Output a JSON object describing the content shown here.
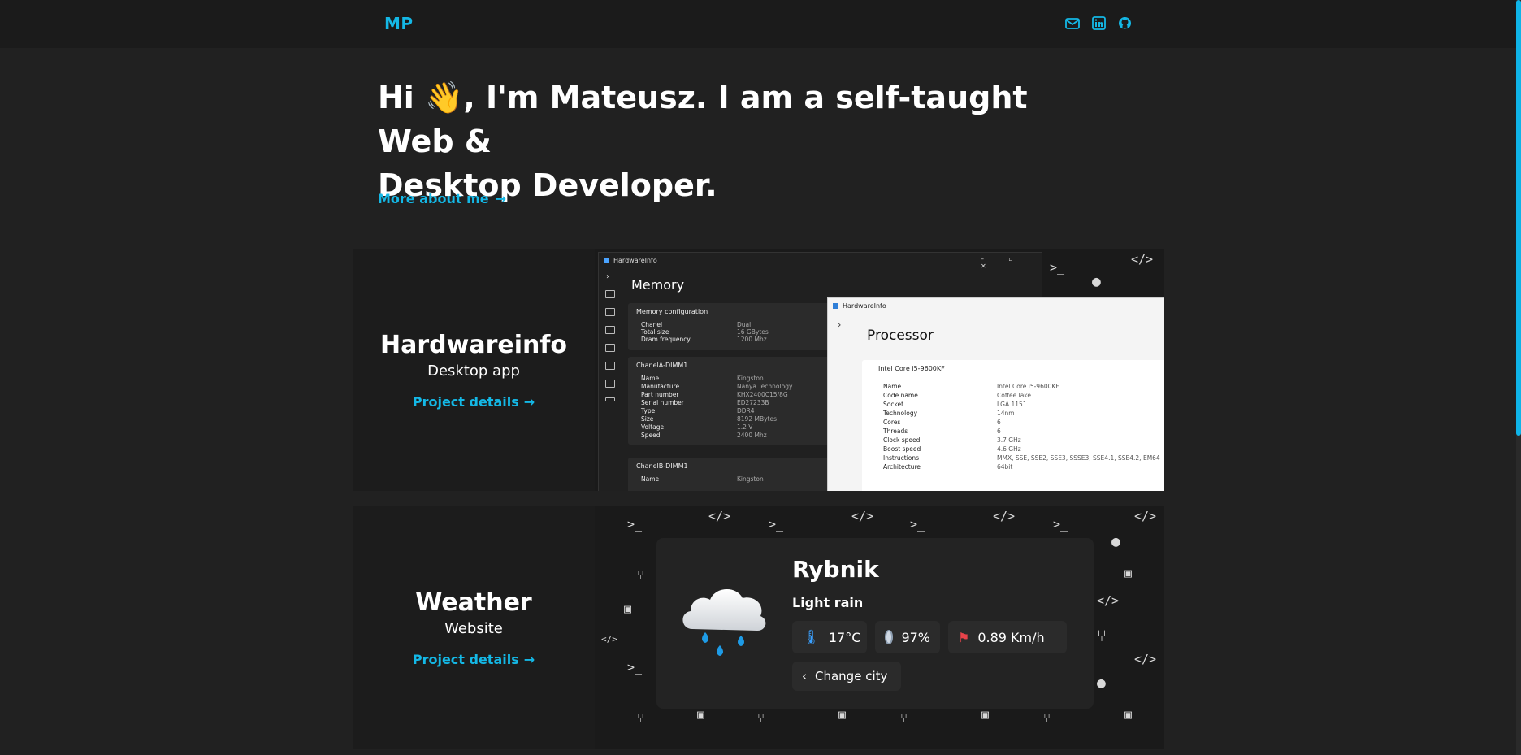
{
  "header": {
    "logo": "MP",
    "social": [
      {
        "icon": "mail-icon",
        "label": "Email"
      },
      {
        "icon": "linkedin-icon",
        "label": "LinkedIn"
      },
      {
        "icon": "github-icon",
        "label": "GitHub"
      }
    ]
  },
  "hero": {
    "line1_pre": "Hi ",
    "wave": "👋",
    "line1_post": ", I'm Mateusz. I am a self-taught Web &",
    "line2": "Desktop Developer.",
    "more_link": "More about me",
    "arrow": "→"
  },
  "projects": [
    {
      "title": "Hardwareinfo",
      "subtitle": "Desktop app",
      "link": "Project details",
      "screenshot_dark": {
        "app_name": "HardwareInfo",
        "page_title": "Memory",
        "sections": [
          {
            "heading": "Memory configuration",
            "rows": [
              [
                "Chanel",
                "Dual"
              ],
              [
                "Total size",
                "16 GBytes"
              ],
              [
                "Dram frequency",
                "1200 Mhz"
              ]
            ]
          },
          {
            "heading": "ChanelA-DIMM1",
            "rows": [
              [
                "Name",
                "Kingston"
              ],
              [
                "Manufacture",
                "Nanya Technology"
              ],
              [
                "Part number",
                "KHX2400C15/8G"
              ],
              [
                "Serial number",
                "ED27233B"
              ],
              [
                "Type",
                "DDR4"
              ],
              [
                "Size",
                "8192 MBytes"
              ],
              [
                "Voltage",
                "1.2 V"
              ],
              [
                "Speed",
                "2400 Mhz"
              ]
            ]
          },
          {
            "heading": "ChanelB-DIMM1",
            "rows": [
              [
                "Name",
                "Kingston"
              ]
            ]
          }
        ]
      },
      "screenshot_light": {
        "app_name": "HardwareInfo",
        "page_title": "Processor",
        "cpu": "Intel Core i5-9600KF",
        "rows": [
          [
            "Name",
            "Intel Core i5-9600KF"
          ],
          [
            "Code name",
            "Coffee lake"
          ],
          [
            "Socket",
            "LGA 1151"
          ],
          [
            "Technology",
            "14nm"
          ],
          [
            "Cores",
            "6"
          ],
          [
            "Threads",
            "6"
          ],
          [
            "Clock speed",
            "3.7 GHz"
          ],
          [
            "Boost speed",
            "4.6 GHz"
          ],
          [
            "Instructions",
            "MMX, SSE, SSE2, SSE3, SSSE3, SSE4.1, SSE4.2, EM64"
          ],
          [
            "Architecture",
            "64bit"
          ]
        ]
      }
    },
    {
      "title": "Weather",
      "subtitle": "Website",
      "link": "Project details",
      "weather": {
        "city": "Rybnik",
        "condition": "Light rain",
        "temperature": "17°C",
        "humidity": "97%",
        "wind": "0.89 Km/h",
        "change_city": "Change city"
      }
    }
  ],
  "colors": {
    "accent": "#14b8e6",
    "background": "#212121",
    "card": "#1c1c1c"
  }
}
